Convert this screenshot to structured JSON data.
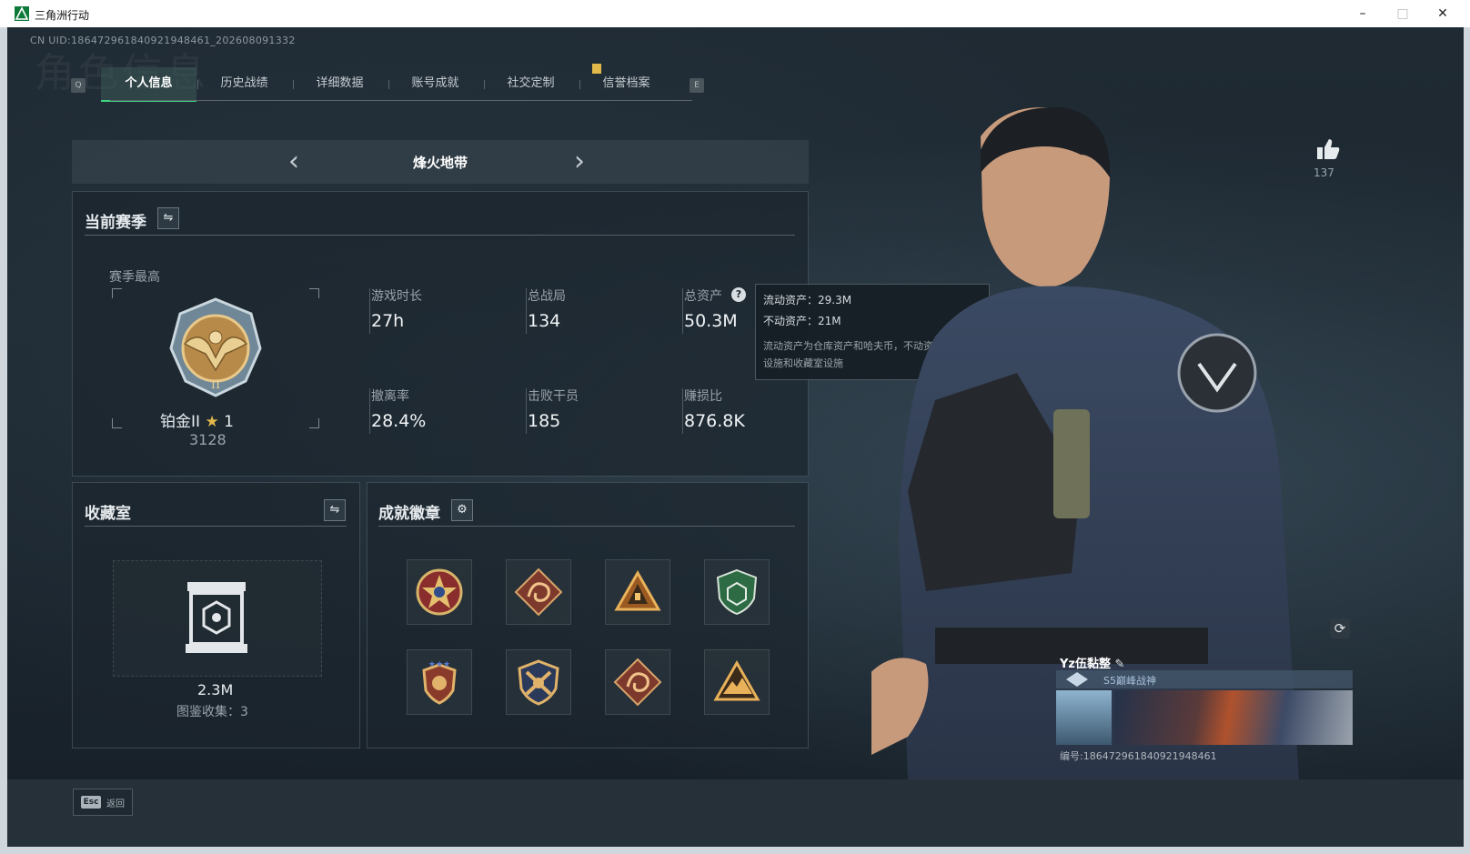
{
  "app": {
    "title": "三角洲行动"
  },
  "window_controls": {
    "minimize": "–",
    "maximize": "□",
    "close": "✕"
  },
  "uid_text": "CN UID:1864729618409219484​61_202608091332",
  "watermark": "角色信息",
  "tabs": {
    "left_key": "Q",
    "right_key": "E",
    "items": [
      {
        "label": "个人信息"
      },
      {
        "label": "历史战绩"
      },
      {
        "label": "详细数据"
      },
      {
        "label": "账号成就"
      },
      {
        "label": "社交定制"
      },
      {
        "label": "信誉档案"
      }
    ],
    "active_index": 0
  },
  "mode_selector": {
    "title": "烽火地带",
    "prev": "‹",
    "next": "›"
  },
  "season": {
    "title": "当前赛季",
    "switch_icon": "⇋",
    "highest_label": "赛季最高",
    "rank_name": "铂金II",
    "rank_star_count": "1",
    "rank_score": "3128",
    "stats": [
      {
        "label": "游戏时长",
        "value": "27h"
      },
      {
        "label": "总战局",
        "value": "134"
      },
      {
        "label": "总资产",
        "value": "50.3M"
      },
      {
        "label": "撤离率",
        "value": "28.4%"
      },
      {
        "label": "击败干员",
        "value": "185"
      },
      {
        "label": "赚损比",
        "value": "876.8K"
      }
    ],
    "help_icon": "?"
  },
  "tooltip": {
    "liquid": "流动资产：29.3M",
    "fixed": "不动资产：21M",
    "description": "流动资产为仓库资产和哈夫币，不动资产为特勤处设施和收藏室设施"
  },
  "collection": {
    "title": "收藏室",
    "switch_icon": "⇋",
    "value": "2.3M",
    "catalog": "图鉴收集：3"
  },
  "achievements": {
    "title": "成就徽章",
    "settings_icon": "⚙",
    "badges": [
      "star-medal",
      "dragon-medal",
      "pyramid-medal",
      "shield-medal",
      "winged-shield-medal",
      "crossed-arms-medal",
      "dragon-medal-2",
      "mountain-medal"
    ]
  },
  "likes": {
    "count": "137"
  },
  "refresh_icon": "⟳",
  "profile_card": {
    "name": "Yz伍黏整",
    "edit_icon": "✎",
    "rank": "S5巅峰战神",
    "id_line": "编号:1864729618409219484​61"
  },
  "footer": {
    "esc_key": "Esc",
    "esc_label": "返回"
  },
  "colors": {
    "accent_green": "#3fd17e",
    "notice_yellow": "#e1b84a",
    "panel_bg": "#1c262e"
  }
}
